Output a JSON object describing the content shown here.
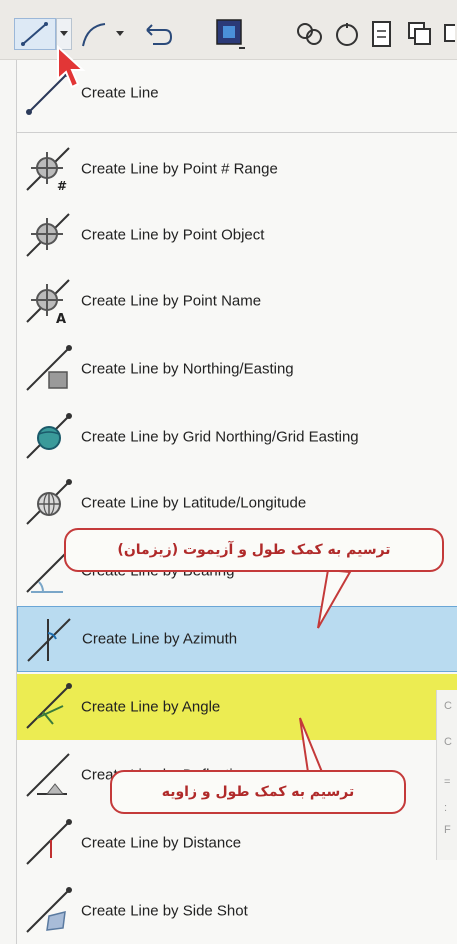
{
  "menu": {
    "items": [
      {
        "label": "Create Line",
        "icon": "line-icon"
      },
      {
        "label": "Create Line by Point # Range",
        "icon": "point-range-icon"
      },
      {
        "label": "Create Line by Point Object",
        "icon": "point-object-icon"
      },
      {
        "label": "Create Line by Point Name",
        "icon": "point-name-icon"
      },
      {
        "label": "Create Line by Northing/Easting",
        "icon": "northing-easting-icon"
      },
      {
        "label": "Create Line by Grid Northing/Grid Easting",
        "icon": "grid-globe-icon"
      },
      {
        "label": "Create Line by Latitude/Longitude",
        "icon": "latlong-globe-icon"
      },
      {
        "label": "Create Line by Bearing",
        "icon": "bearing-icon"
      },
      {
        "label": "Create Line by Azimuth",
        "icon": "azimuth-icon"
      },
      {
        "label": "Create Line by Angle",
        "icon": "angle-icon"
      },
      {
        "label": "Create Line by Deflection",
        "icon": "deflection-icon"
      },
      {
        "label": "Create Line by Distance",
        "icon": "distance-icon"
      },
      {
        "label": "Create Line by Side Shot",
        "icon": "side-shot-icon"
      }
    ],
    "highlight_colors": {
      "hovered": "#b9dbf0",
      "marked": "#ecec52"
    }
  },
  "callouts": {
    "azimuth": "ترسیم به کمک طول و آزیموت (زیزمان)",
    "angle": "ترسیم به کمک طول و زاویه"
  },
  "colors": {
    "callout_border": "#c43a3a",
    "callout_text": "#b02a2a"
  }
}
